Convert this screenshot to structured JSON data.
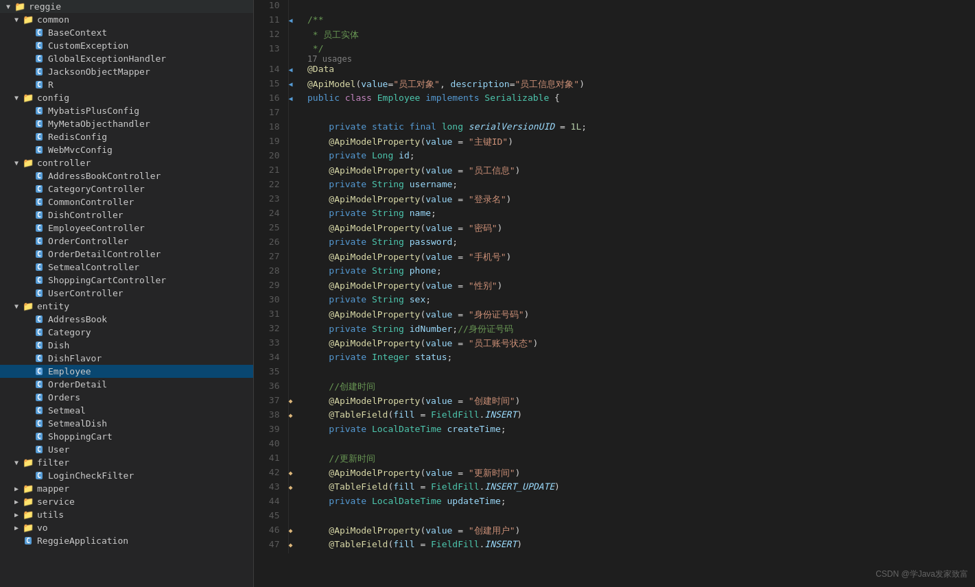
{
  "sidebar": {
    "root": "reggie",
    "groups": [
      {
        "name": "common",
        "level": 1,
        "expanded": true,
        "items": [
          {
            "name": "BaseContext",
            "type": "C"
          },
          {
            "name": "CustomException",
            "type": "C"
          },
          {
            "name": "GlobalExceptionHandler",
            "type": "C"
          },
          {
            "name": "JacksonObjectMapper",
            "type": "C"
          },
          {
            "name": "R",
            "type": "C"
          }
        ]
      },
      {
        "name": "config",
        "level": 1,
        "expanded": true,
        "items": [
          {
            "name": "MybatisPlusConfig",
            "type": "C"
          },
          {
            "name": "MyMetaObjecthandler",
            "type": "C"
          },
          {
            "name": "RedisConfig",
            "type": "C"
          },
          {
            "name": "WebMvcConfig",
            "type": "C"
          }
        ]
      },
      {
        "name": "controller",
        "level": 1,
        "expanded": true,
        "items": [
          {
            "name": "AddressBookController",
            "type": "C"
          },
          {
            "name": "CategoryController",
            "type": "C"
          },
          {
            "name": "CommonController",
            "type": "C"
          },
          {
            "name": "DishController",
            "type": "C"
          },
          {
            "name": "EmployeeController",
            "type": "C"
          },
          {
            "name": "OrderController",
            "type": "C"
          },
          {
            "name": "OrderDetailController",
            "type": "C"
          },
          {
            "name": "SetmealController",
            "type": "C"
          },
          {
            "name": "ShoppingCartController",
            "type": "C"
          },
          {
            "name": "UserController",
            "type": "C"
          }
        ]
      },
      {
        "name": "entity",
        "level": 1,
        "expanded": true,
        "items": [
          {
            "name": "AddressBook",
            "type": "C"
          },
          {
            "name": "Category",
            "type": "C"
          },
          {
            "name": "Dish",
            "type": "C"
          },
          {
            "name": "DishFlavor",
            "type": "C"
          },
          {
            "name": "Employee",
            "type": "C",
            "selected": true
          },
          {
            "name": "OrderDetail",
            "type": "C"
          },
          {
            "name": "Orders",
            "type": "C"
          },
          {
            "name": "Setmeal",
            "type": "C"
          },
          {
            "name": "SetmealDish",
            "type": "C"
          },
          {
            "name": "ShoppingCart",
            "type": "C"
          },
          {
            "name": "User",
            "type": "C"
          }
        ]
      },
      {
        "name": "filter",
        "level": 1,
        "expanded": true,
        "items": [
          {
            "name": "LoginCheckFilter",
            "type": "C"
          }
        ]
      },
      {
        "name": "mapper",
        "level": 1,
        "expanded": false,
        "items": []
      },
      {
        "name": "service",
        "level": 1,
        "expanded": false,
        "items": []
      },
      {
        "name": "utils",
        "level": 1,
        "expanded": false,
        "items": []
      },
      {
        "name": "vo",
        "level": 1,
        "expanded": false,
        "items": []
      }
    ],
    "app_item": "ReggieApplication"
  },
  "code": {
    "lines": [
      {
        "num": 10,
        "content": ""
      },
      {
        "num": 11,
        "content": "/**",
        "type": "comment"
      },
      {
        "num": 12,
        "content": " * 员工实体",
        "type": "comment"
      },
      {
        "num": 13,
        "content": " */",
        "type": "comment"
      },
      {
        "num": 14,
        "content": "@Data",
        "type": "annotation"
      },
      {
        "num": 15,
        "content": "@ApiModel(value=\"员工对象\", description=\"员工信息对象\")",
        "type": "annotation"
      },
      {
        "num": 16,
        "content": "public class Employee implements Serializable {",
        "type": "code"
      },
      {
        "num": 17,
        "content": ""
      },
      {
        "num": 18,
        "content": "    private static final long serialVersionUID = 1L;",
        "type": "code"
      },
      {
        "num": 19,
        "content": "    @ApiModelProperty(value = \"主键ID\")",
        "type": "annotation"
      },
      {
        "num": 20,
        "content": "    private Long id;",
        "type": "code"
      },
      {
        "num": 21,
        "content": "    @ApiModelProperty(value = \"员工信息\")",
        "type": "annotation"
      },
      {
        "num": 22,
        "content": "    private String username;",
        "type": "code"
      },
      {
        "num": 23,
        "content": "    @ApiModelProperty(value = \"登录名\")",
        "type": "annotation"
      },
      {
        "num": 24,
        "content": "    private String name;",
        "type": "code"
      },
      {
        "num": 25,
        "content": "    @ApiModelProperty(value = \"密码\")",
        "type": "annotation"
      },
      {
        "num": 26,
        "content": "    private String password;",
        "type": "code"
      },
      {
        "num": 27,
        "content": "    @ApiModelProperty(value = \"手机号\")",
        "type": "annotation"
      },
      {
        "num": 28,
        "content": "    private String phone;",
        "type": "code"
      },
      {
        "num": 29,
        "content": "    @ApiModelProperty(value = \"性别\")",
        "type": "annotation"
      },
      {
        "num": 30,
        "content": "    private String sex;",
        "type": "code"
      },
      {
        "num": 31,
        "content": "    @ApiModelProperty(value = \"身份证号码\")",
        "type": "annotation"
      },
      {
        "num": 32,
        "content": "    private String idNumber;//身份证号码",
        "type": "code"
      },
      {
        "num": 33,
        "content": "    @ApiModelProperty(value = \"员工账号状态\")",
        "type": "annotation"
      },
      {
        "num": 34,
        "content": "    private Integer status;",
        "type": "code"
      },
      {
        "num": 35,
        "content": ""
      },
      {
        "num": 36,
        "content": "    //创建时间",
        "type": "comment_inline"
      },
      {
        "num": 37,
        "content": "    @ApiModelProperty(value = \"创建时间\")",
        "type": "annotation"
      },
      {
        "num": 38,
        "content": "    @TableField(fill = FieldFill.INSERT)",
        "type": "annotation"
      },
      {
        "num": 39,
        "content": "    private LocalDateTime createTime;",
        "type": "code"
      },
      {
        "num": 40,
        "content": ""
      },
      {
        "num": 41,
        "content": "    //更新时间",
        "type": "comment_inline"
      },
      {
        "num": 42,
        "content": "    @ApiModelProperty(value = \"更新时间\")",
        "type": "annotation"
      },
      {
        "num": 43,
        "content": "    @TableField(fill = FieldFill.INSERT_UPDATE)",
        "type": "annotation"
      },
      {
        "num": 44,
        "content": "    private LocalDateTime updateTime;",
        "type": "code"
      },
      {
        "num": 45,
        "content": ""
      },
      {
        "num": 46,
        "content": "    @ApiModelProperty(value = \"创建用户\")",
        "type": "annotation"
      },
      {
        "num": 47,
        "content": "    @TableField(fill = FieldFill.INSERT)",
        "type": "annotation"
      }
    ],
    "usages_line": 13,
    "usages_text": "17 usages"
  },
  "watermark": "CSDN @学Java发家致富"
}
